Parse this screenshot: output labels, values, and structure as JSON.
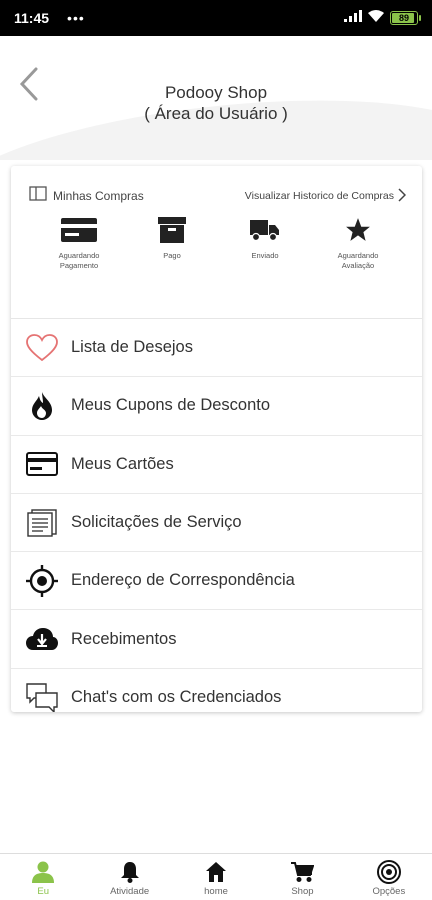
{
  "status_bar": {
    "time": "11:45",
    "dots": "•••",
    "battery_level": "89"
  },
  "header": {
    "title_line1": "Podooy Shop",
    "title_line2": "( Área do Usuário )",
    "back_icon": "chevron-left-icon"
  },
  "orders": {
    "title": "Minhas Compras",
    "history_link": "Visualizar Historico de Compras",
    "items": [
      {
        "label_line1": "Aguardando",
        "label_line2": "Pagamento",
        "icon": "credit-card-icon"
      },
      {
        "label_line1": "Pago",
        "label_line2": "",
        "icon": "box-icon"
      },
      {
        "label_line1": "Enviado",
        "label_line2": "",
        "icon": "truck-icon"
      },
      {
        "label_line1": "Aguardando",
        "label_line2": "Avaliação",
        "icon": "star-icon"
      }
    ]
  },
  "menu": [
    {
      "label": "Lista de Desejos",
      "icon": "heart-icon"
    },
    {
      "label": "Meus Cupons de Desconto",
      "icon": "flame-icon"
    },
    {
      "label": "Meus Cartões",
      "icon": "credit-card-icon"
    },
    {
      "label": "Solicitações de Serviço",
      "icon": "document-icon"
    },
    {
      "label": "Endereço de Correspondência",
      "icon": "target-icon"
    },
    {
      "label": "Recebimentos",
      "icon": "cloud-download-icon"
    },
    {
      "label": "Chat's com os Credenciados",
      "icon": "chat-icon"
    }
  ],
  "tabs": [
    {
      "label": "Eu",
      "icon": "user-icon",
      "active": true
    },
    {
      "label": "Atividade",
      "icon": "bell-icon"
    },
    {
      "label": "home",
      "icon": "home-icon"
    },
    {
      "label": "Shop",
      "icon": "cart-icon"
    },
    {
      "label": "Opções",
      "icon": "options-icon"
    }
  ],
  "colors": {
    "accent": "#8bc34a",
    "heart": "#e57373",
    "icon_dark": "#222222"
  }
}
